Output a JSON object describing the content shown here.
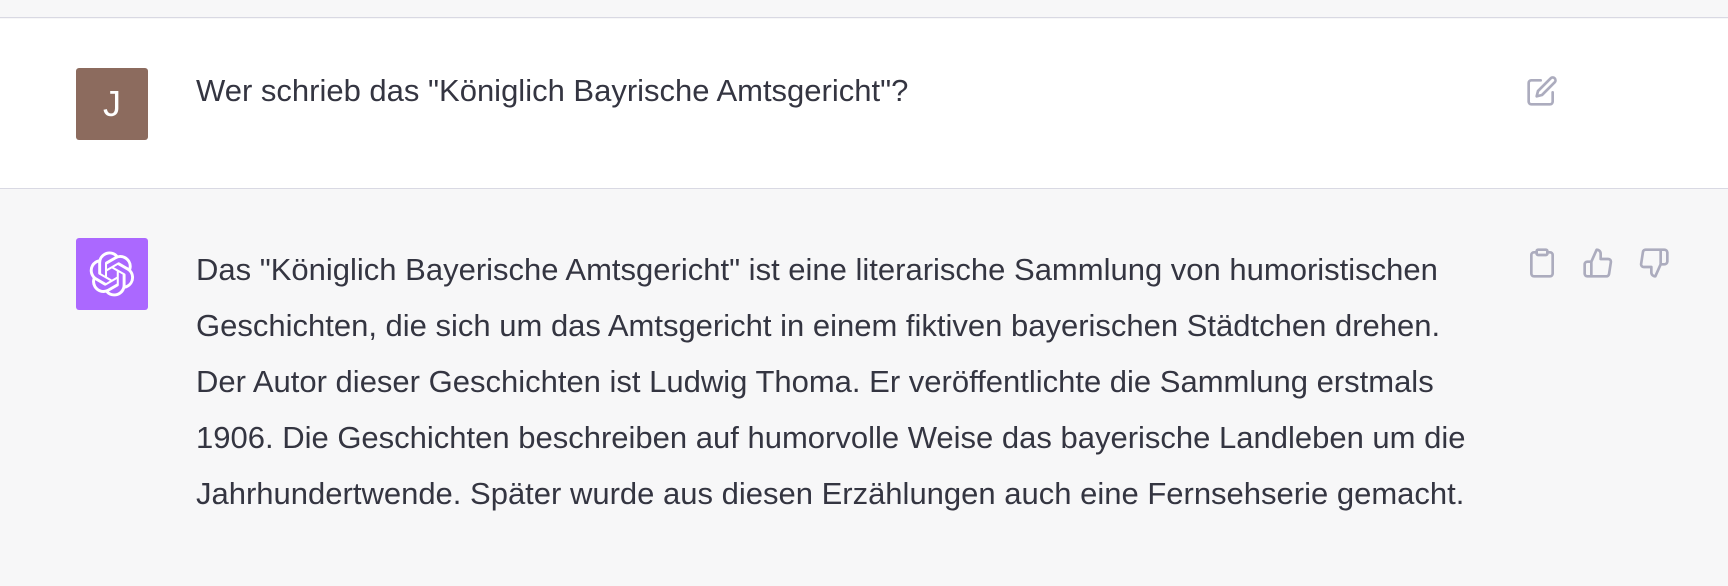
{
  "conversation": {
    "user_message": {
      "avatar_letter": "J",
      "text": "Wer schrieb das \"Königlich Bayrische Amtsgericht\"?"
    },
    "assistant_message": {
      "lines": [
        "Das \"Königlich Bayerische Amtsgericht\" ist eine literarische Sammlung von humoristischen",
        "Geschichten, die sich um das Amtsgericht in einem fiktiven bayerischen Städtchen drehen.",
        "Der Autor dieser Geschichten ist Ludwig Thoma. Er veröffentlichte die Sammlung erstmals",
        "1906. Die Geschichten beschreiben auf humorvolle Weise das bayerische Landleben um die",
        "Jahrhundertwende. Später wurde aus diesen Erzählungen auch eine Fernsehserie gemacht."
      ]
    }
  },
  "icons": {
    "edit": "edit-icon",
    "copy": "clipboard-icon",
    "like": "thumbs-up-icon",
    "dislike": "thumbs-down-icon",
    "bot": "openai-logo-icon"
  },
  "colors": {
    "user_avatar_bg": "#8c6b5e",
    "bot_avatar_bg": "#ab68ff",
    "text": "#343541",
    "icon": "#acacbe"
  }
}
